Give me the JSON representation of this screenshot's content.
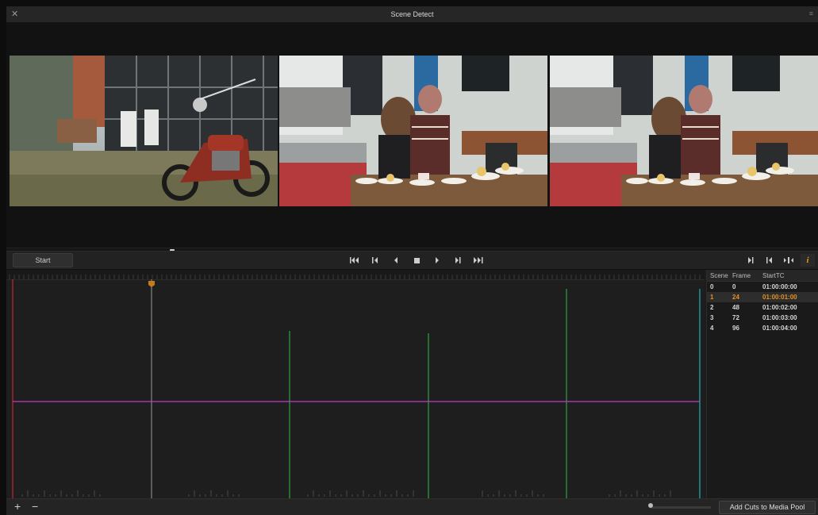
{
  "window": {
    "title": "Scene Detect"
  },
  "viewer": {
    "thumbnails": [
      {
        "name": "motorcycle-scene"
      },
      {
        "name": "cafe-scene-a"
      },
      {
        "name": "cafe-scene-b"
      }
    ]
  },
  "toolbar": {
    "start_label": "Start",
    "transport_icons": [
      "go-to-start-icon",
      "step-back-icon",
      "play-reverse-icon",
      "stop-icon",
      "play-icon",
      "step-forward-icon",
      "go-to-end-icon"
    ],
    "right_icons": [
      "mark-in-icon",
      "mark-out-icon",
      "cut-icon",
      "info-icon"
    ]
  },
  "scene_table": {
    "headers": [
      "Scene",
      "Frame",
      "StartTC"
    ],
    "rows": [
      [
        "0",
        "0",
        "01:00:00:00"
      ],
      [
        "1",
        "24",
        "01:00:01:00"
      ],
      [
        "2",
        "48",
        "01:00:02:00"
      ],
      [
        "3",
        "72",
        "01:00:03:00"
      ],
      [
        "4",
        "96",
        "01:00:04:00"
      ]
    ],
    "selected_index": 1
  },
  "bottom": {
    "add_cuts_label": "Add Cuts to Media Pool",
    "plus_label": "+",
    "minus_label": "−"
  },
  "colors": {
    "accent": "#e8911f",
    "threshold": "#c13cc4",
    "cut_line": "#2fa33f",
    "start_line": "#c0282f",
    "end_line": "#1fb3b0",
    "playhead": "#9a9a9a"
  }
}
